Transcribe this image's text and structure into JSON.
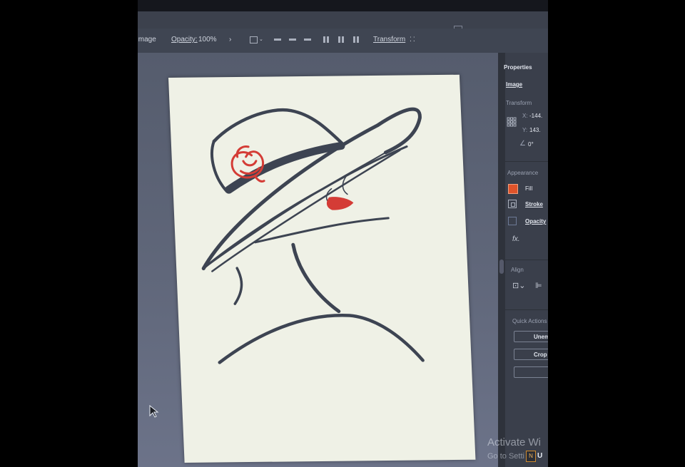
{
  "control_bar": {
    "image_label": "Image",
    "opacity_label": "Opacity:",
    "opacity_value": "100%",
    "transform_label": "Transform"
  },
  "properties_panel": {
    "tab_label": "Properties",
    "section_image": "Image",
    "transform_title": "Transform",
    "x_label": "X:",
    "x_value": "-144.",
    "y_label": "Y:",
    "y_value": "143.",
    "angle_value": "0°",
    "appearance_title": "Appearance",
    "fill_label": "Fill",
    "stroke_label": "Stroke",
    "opacity_label": "Opacity",
    "fx_label": "fx.",
    "align_title": "Align",
    "quick_actions_title": "Quick Actions",
    "qa_button_1": "Unem",
    "qa_button_2": "Crop I"
  },
  "colors": {
    "fill_swatch": "#e0532a",
    "artwork_stroke": "#3d4452",
    "accent_red": "#d43c36"
  },
  "watermark": {
    "line1": "Activate Wi",
    "line2": "Go to Setti"
  },
  "taskbar": {
    "icon_letter": "N",
    "label": "U"
  },
  "icons": [
    "select-tool-icon",
    "align-icon",
    "chevron-right-icon",
    "cursor-icon",
    "reference-point-icon",
    "angle-icon",
    "stroke-icon",
    "opacity-icon"
  ]
}
